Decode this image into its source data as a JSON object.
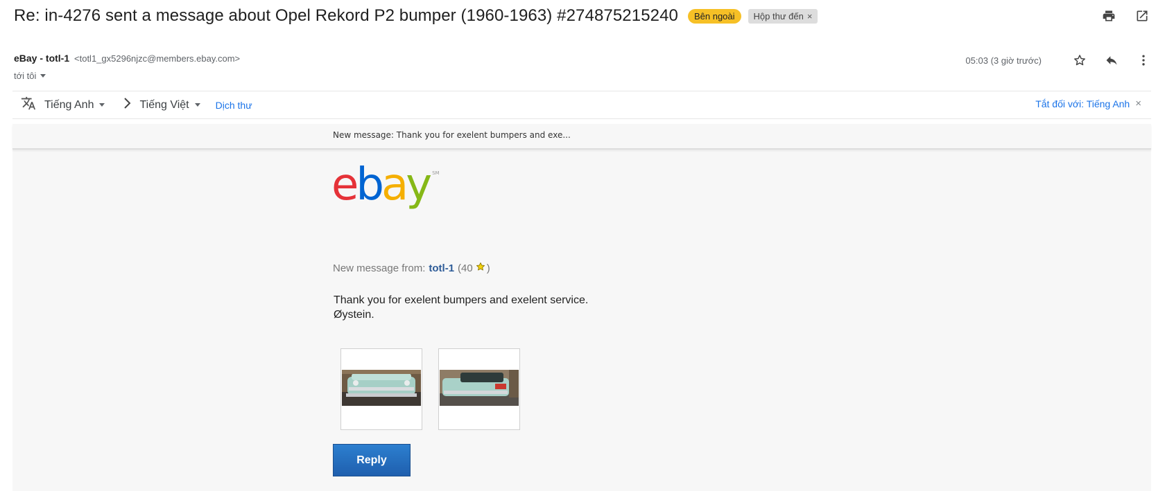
{
  "subject": "Re: in-4276 sent a message about Opel Rekord P2 bumper (1960-1963) #274875215240",
  "labels": {
    "external": "Bên ngoài",
    "inbox": "Hộp thư đến",
    "inbox_remove": "×"
  },
  "top_icons": [
    "print-icon",
    "open-in-new-window-icon"
  ],
  "sender": {
    "name": "eBay - totl-1",
    "email": "<totl1_gx5296njzc@members.ebay.com>",
    "to": "tới tôi"
  },
  "meta": {
    "time": "05:03 (3 giờ trước)",
    "icons": [
      "star-icon",
      "reply-icon",
      "more-vert-icon"
    ]
  },
  "translate": {
    "source_lang": "Tiếng Anh",
    "target_lang": "Tiếng Việt",
    "translate_link": "Dịch thư",
    "turn_off": "Tắt đối với: Tiếng Anh",
    "close": "×"
  },
  "email": {
    "preheader": "New message: Thank you for exelent bumpers and exe...",
    "logo": {
      "letters": [
        "e",
        "b",
        "a",
        "y"
      ],
      "colors": [
        "#e53238",
        "#0064d2",
        "#f5af02",
        "#86b817"
      ],
      "tm": "SM"
    },
    "new_message_prefix": "New message from:",
    "from_name": "totl-1",
    "feedback_open": "(40",
    "feedback_close": ")",
    "body_lines": [
      "Thank you for exelent bumpers and exelent service.",
      "Øystein."
    ],
    "reply_label": "Reply"
  },
  "colors": {
    "accent_link": "#1a73e8",
    "external_chip": "#f6c026",
    "reply_button": "#1f5fae"
  }
}
